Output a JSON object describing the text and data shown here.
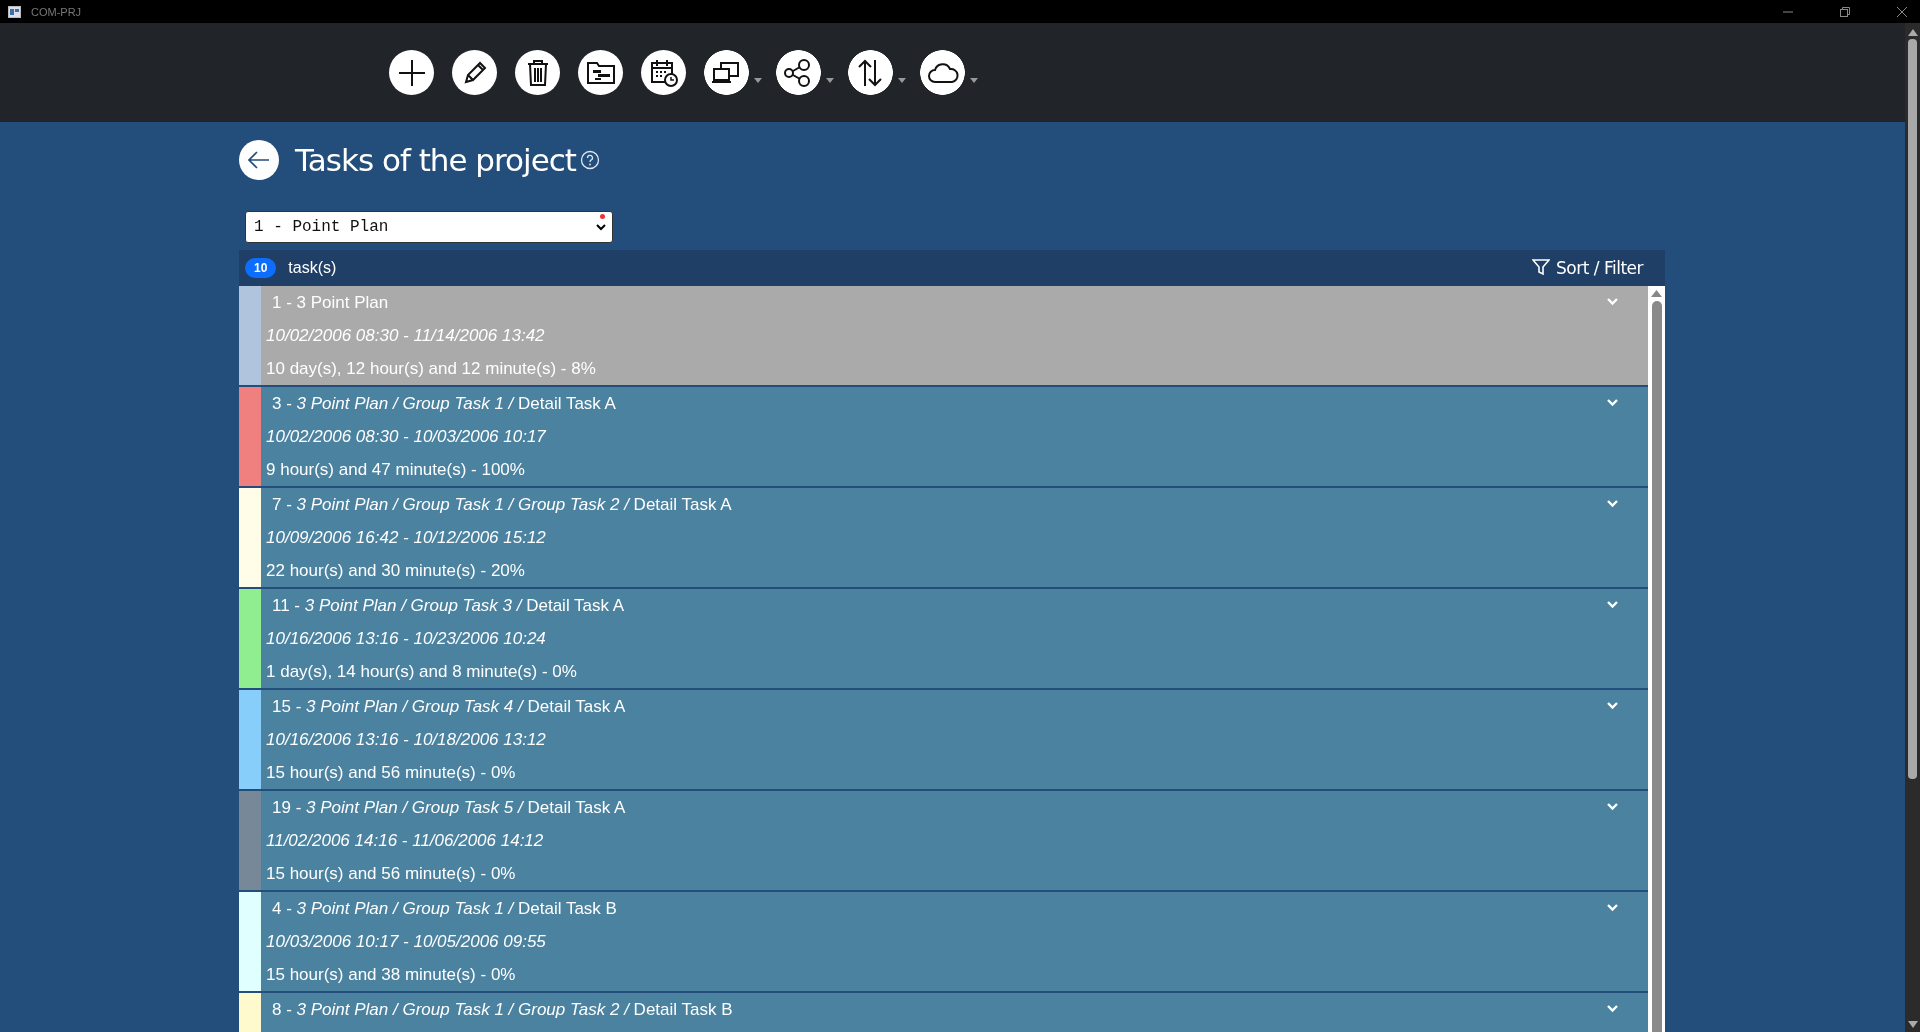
{
  "window": {
    "title": "COM-PRJ"
  },
  "toolbar": [
    {
      "kind": "add",
      "dropdown": false
    },
    {
      "kind": "edit",
      "dropdown": false
    },
    {
      "kind": "delete",
      "dropdown": false
    },
    {
      "kind": "gantt",
      "dropdown": false
    },
    {
      "kind": "calendar",
      "dropdown": false
    },
    {
      "kind": "devices",
      "dropdown": true
    },
    {
      "kind": "share",
      "dropdown": true
    },
    {
      "kind": "sort",
      "dropdown": true
    },
    {
      "kind": "cloud",
      "dropdown": true
    }
  ],
  "page": {
    "title": "Tasks of the project",
    "project_select": {
      "value": "1 - Point Plan",
      "required": true
    }
  },
  "list_header": {
    "count": "10",
    "label": "task(s)",
    "sort_filter": "Sort / Filter"
  },
  "tasks": [
    {
      "title": "1 - 3 Point Plan",
      "dates": "10/02/2006 08:30 - 11/14/2006 13:42",
      "duration": "10 day(s), 12 hour(s) and 12 minute(s) - 8%",
      "color": "#b0c4de",
      "selected": true
    },
    {
      "title": "3 - *3 Point Plan / Group Task 1 /* Detail Task A",
      "dates": "10/02/2006 08:30 - 10/03/2006 10:17",
      "duration": "9 hour(s) and 47 minute(s) - 100%",
      "color": "#f08080",
      "selected": false
    },
    {
      "title": "7 - *3 Point Plan / Group Task 1 / Group Task 2 /* Detail Task A",
      "dates": "10/09/2006 16:42 - 10/12/2006 15:12",
      "duration": "22 hour(s) and 30 minute(s) - 20%",
      "color": "#fffde7",
      "selected": false
    },
    {
      "title": "11 - *3 Point Plan / Group Task 3 /* Detail Task A",
      "dates": "10/16/2006 13:16 - 10/23/2006 10:24",
      "duration": "1 day(s), 14 hour(s) and 8 minute(s) - 0%",
      "color": "#90ee90",
      "selected": false
    },
    {
      "title": "15 - *3 Point Plan / Group Task 4 /* Detail Task A",
      "dates": "10/16/2006 13:16 - 10/18/2006 13:12",
      "duration": "15 hour(s) and 56 minute(s) - 0%",
      "color": "#87cefa",
      "selected": false
    },
    {
      "title": "19 - *3 Point Plan / Group Task 5 /* Detail Task A",
      "dates": "11/02/2006 14:16 - 11/06/2006 14:12",
      "duration": "15 hour(s) and 56 minute(s) - 0%",
      "color": "#778899",
      "selected": false
    },
    {
      "title": "4 - *3 Point Plan / Group Task 1 /* Detail Task B",
      "dates": "10/03/2006 10:17 - 10/05/2006 09:55",
      "duration": "15 hour(s) and 38 minute(s) - 0%",
      "color": "#e0ffff",
      "selected": false
    },
    {
      "title": "8 - *3 Point Plan / Group Task 1 / Group Task 2 /* Detail Task B",
      "color": "#fffacd",
      "selected": false
    }
  ]
}
